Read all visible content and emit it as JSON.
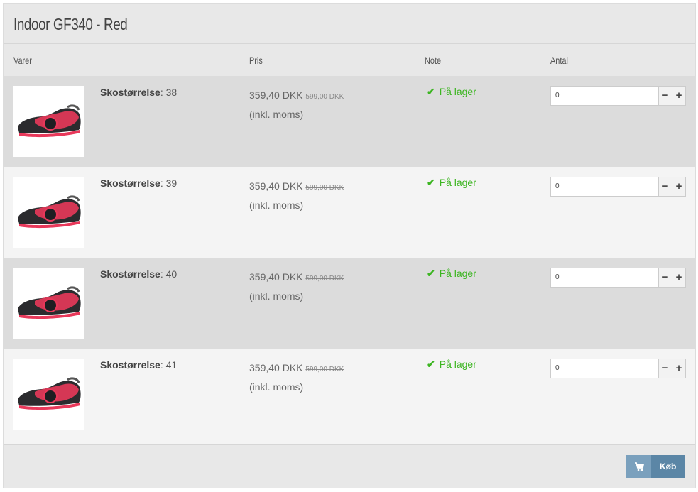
{
  "product": {
    "title": "Indoor GF340 - Red"
  },
  "columns": {
    "items": "Varer",
    "price": "Pris",
    "note": "Note",
    "qty": "Antal"
  },
  "rows": [
    {
      "size_label": "Skostørrelse",
      "size_value": ": 38",
      "price": "359,40 DKK",
      "old_price": "599,00 DKK",
      "vat": "(inkl. moms)",
      "stock": "På lager",
      "qty": "0"
    },
    {
      "size_label": "Skostørrelse",
      "size_value": ": 39",
      "price": "359,40 DKK",
      "old_price": "599,00 DKK",
      "vat": "(inkl. moms)",
      "stock": "På lager",
      "qty": "0"
    },
    {
      "size_label": "Skostørrelse",
      "size_value": ": 40",
      "price": "359,40 DKK",
      "old_price": "599,00 DKK",
      "vat": "(inkl. moms)",
      "stock": "På lager",
      "qty": "0"
    },
    {
      "size_label": "Skostørrelse",
      "size_value": ": 41",
      "price": "359,40 DKK",
      "old_price": "599,00 DKK",
      "vat": "(inkl. moms)",
      "stock": "På lager",
      "qty": "0"
    }
  ],
  "buttons": {
    "minus": "−",
    "plus": "+",
    "buy": "Køb"
  },
  "icons": {
    "stock": "checkmark-icon",
    "buy": "cart-icon",
    "minus": "minus-icon",
    "plus": "plus-icon"
  },
  "colors": {
    "accent": "#5b86a6",
    "stock": "#3cb521",
    "shoe_red": "#e8385a"
  }
}
